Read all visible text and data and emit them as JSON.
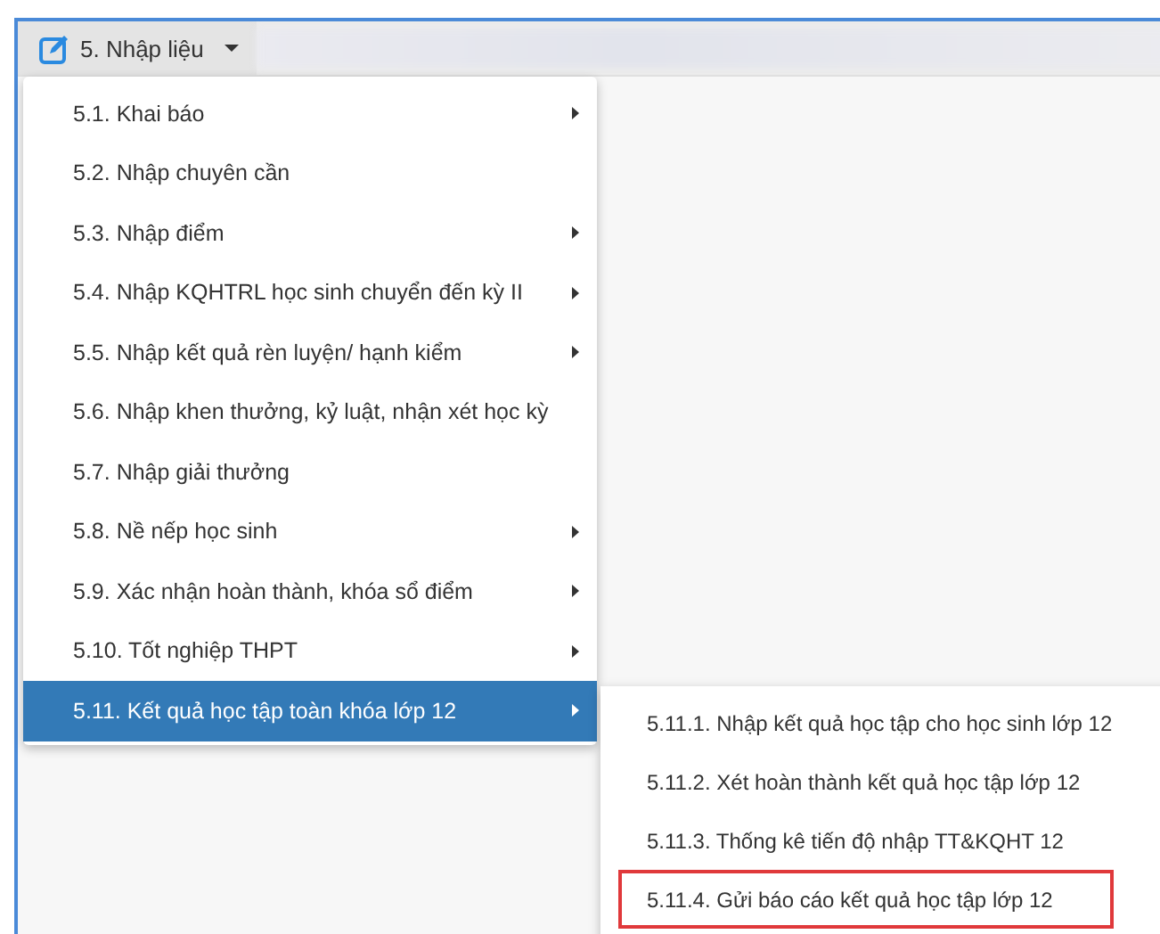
{
  "toolbar": {
    "menu_button": {
      "label": "5. Nhập liệu",
      "expanded": true
    }
  },
  "menu": {
    "items": [
      {
        "label": "5.1. Khai báo",
        "has_submenu": true,
        "selected": false
      },
      {
        "label": "5.2. Nhập chuyên cần",
        "has_submenu": false,
        "selected": false
      },
      {
        "label": "5.3. Nhập điểm",
        "has_submenu": true,
        "selected": false
      },
      {
        "label": "5.4. Nhập KQHTRL học sinh chuyển đến kỳ II",
        "has_submenu": true,
        "selected": false
      },
      {
        "label": "5.5. Nhập kết quả rèn luyện/ hạnh kiểm",
        "has_submenu": true,
        "selected": false
      },
      {
        "label": "5.6. Nhập khen thưởng, kỷ luật, nhận xét học kỳ",
        "has_submenu": false,
        "selected": false
      },
      {
        "label": "5.7. Nhập giải thưởng",
        "has_submenu": false,
        "selected": false
      },
      {
        "label": "5.8. Nề nếp học sinh",
        "has_submenu": true,
        "selected": false
      },
      {
        "label": "5.9. Xác nhận hoàn thành, khóa sổ điểm",
        "has_submenu": true,
        "selected": false
      },
      {
        "label": "5.10. Tốt nghiệp THPT",
        "has_submenu": true,
        "selected": false
      },
      {
        "label": "5.11. Kết quả học tập toàn khóa lớp 12",
        "has_submenu": true,
        "selected": true
      }
    ]
  },
  "submenu": {
    "items": [
      {
        "label": "5.11.1. Nhập kết quả học tập cho học sinh lớp 12",
        "outlined": false
      },
      {
        "label": "5.11.2. Xét hoàn thành kết quả học tập lớp 12",
        "outlined": false
      },
      {
        "label": "5.11.3. Thống kê tiến độ nhập TT&KQHT 12",
        "outlined": false
      },
      {
        "label": "5.11.4. Gửi báo cáo kết quả học tập lớp 12",
        "outlined": true
      }
    ]
  }
}
